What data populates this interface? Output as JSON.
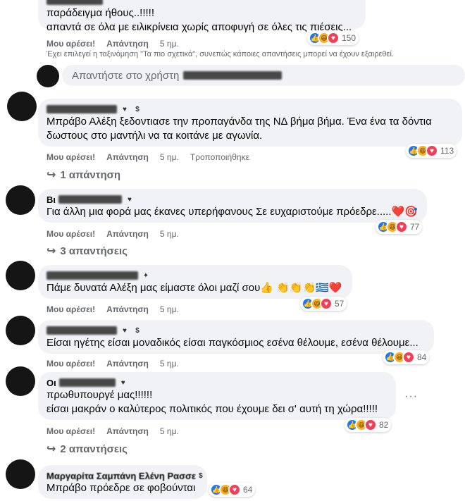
{
  "common": {
    "like": "Μου αρέσει!",
    "reply": "Απάντηση",
    "time": "5 ημ."
  },
  "comment0": {
    "author": "...",
    "lines": [
      "παράδειγμα ήθους..!!!!!",
      "απαντά σε όλα με ειλικρίνεια χωρίς αποφυγή σε όλες τις πιέσεις..."
    ],
    "reactions": "150"
  },
  "sort_note": "Έχει επιλεγεί η ταξινόμηση \"Τα πιο σχετικά\", συνεπώς κάποιες απαντήσεις μπορεί να έχουν εξαιρεθεί.",
  "reply_box": {
    "placeholder": "Απαντήστε στο χρήστη"
  },
  "comment1": {
    "lines": [
      "Μπράβο Αλέξη ξεδοντιασε την προπαγάνδα της ΝΔ βήμα βήμα. Ένα ένα τα δόντια",
      "δωστους στο μαντήλι να τα κοιτάνε με αγωνία."
    ],
    "edited": "Τροποποιήθηκε",
    "reactions": "113",
    "replies": "1 απάντηση"
  },
  "comment2": {
    "author_prefix": "Βι",
    "lines": [
      "Για άλλη μια φορά μας έκανες υπερήφανους Σε ευχαριστούμε πρόεδρε.....❤️🎯"
    ],
    "reactions": "77",
    "replies": "3 απαντήσεις"
  },
  "comment3": {
    "lines": [
      "Πάμε δυνατά Αλέξη μας είμαστε όλοι μαζί σου👍 👏👏👏🇬🇷❤️"
    ],
    "reactions": "57"
  },
  "comment4": {
    "lines": [
      "Είσαι ηγέτης είσαι μοναδικός είσαι παγκόσμιος εσένα θέλουμε, εσένα θέλουμε..."
    ],
    "reactions": "84"
  },
  "comment5": {
    "author_prefix": "Οι",
    "lines": [
      "πρωθυπουργέ μας!!!!!!",
      "είσαι μακράν ο καλύτερος πολιτικός που έχουμε δει σ' αυτή τη χώρα!!!!!"
    ],
    "reactions": "82",
    "replies": "2 απαντήσεις"
  },
  "comment6": {
    "author": "Μαργαρίτα Σαμπάνη Ελένη Ρασσε",
    "lines": [
      "Μπράβο πρόεδρε σε φοβούνται"
    ],
    "reactions": "64"
  }
}
